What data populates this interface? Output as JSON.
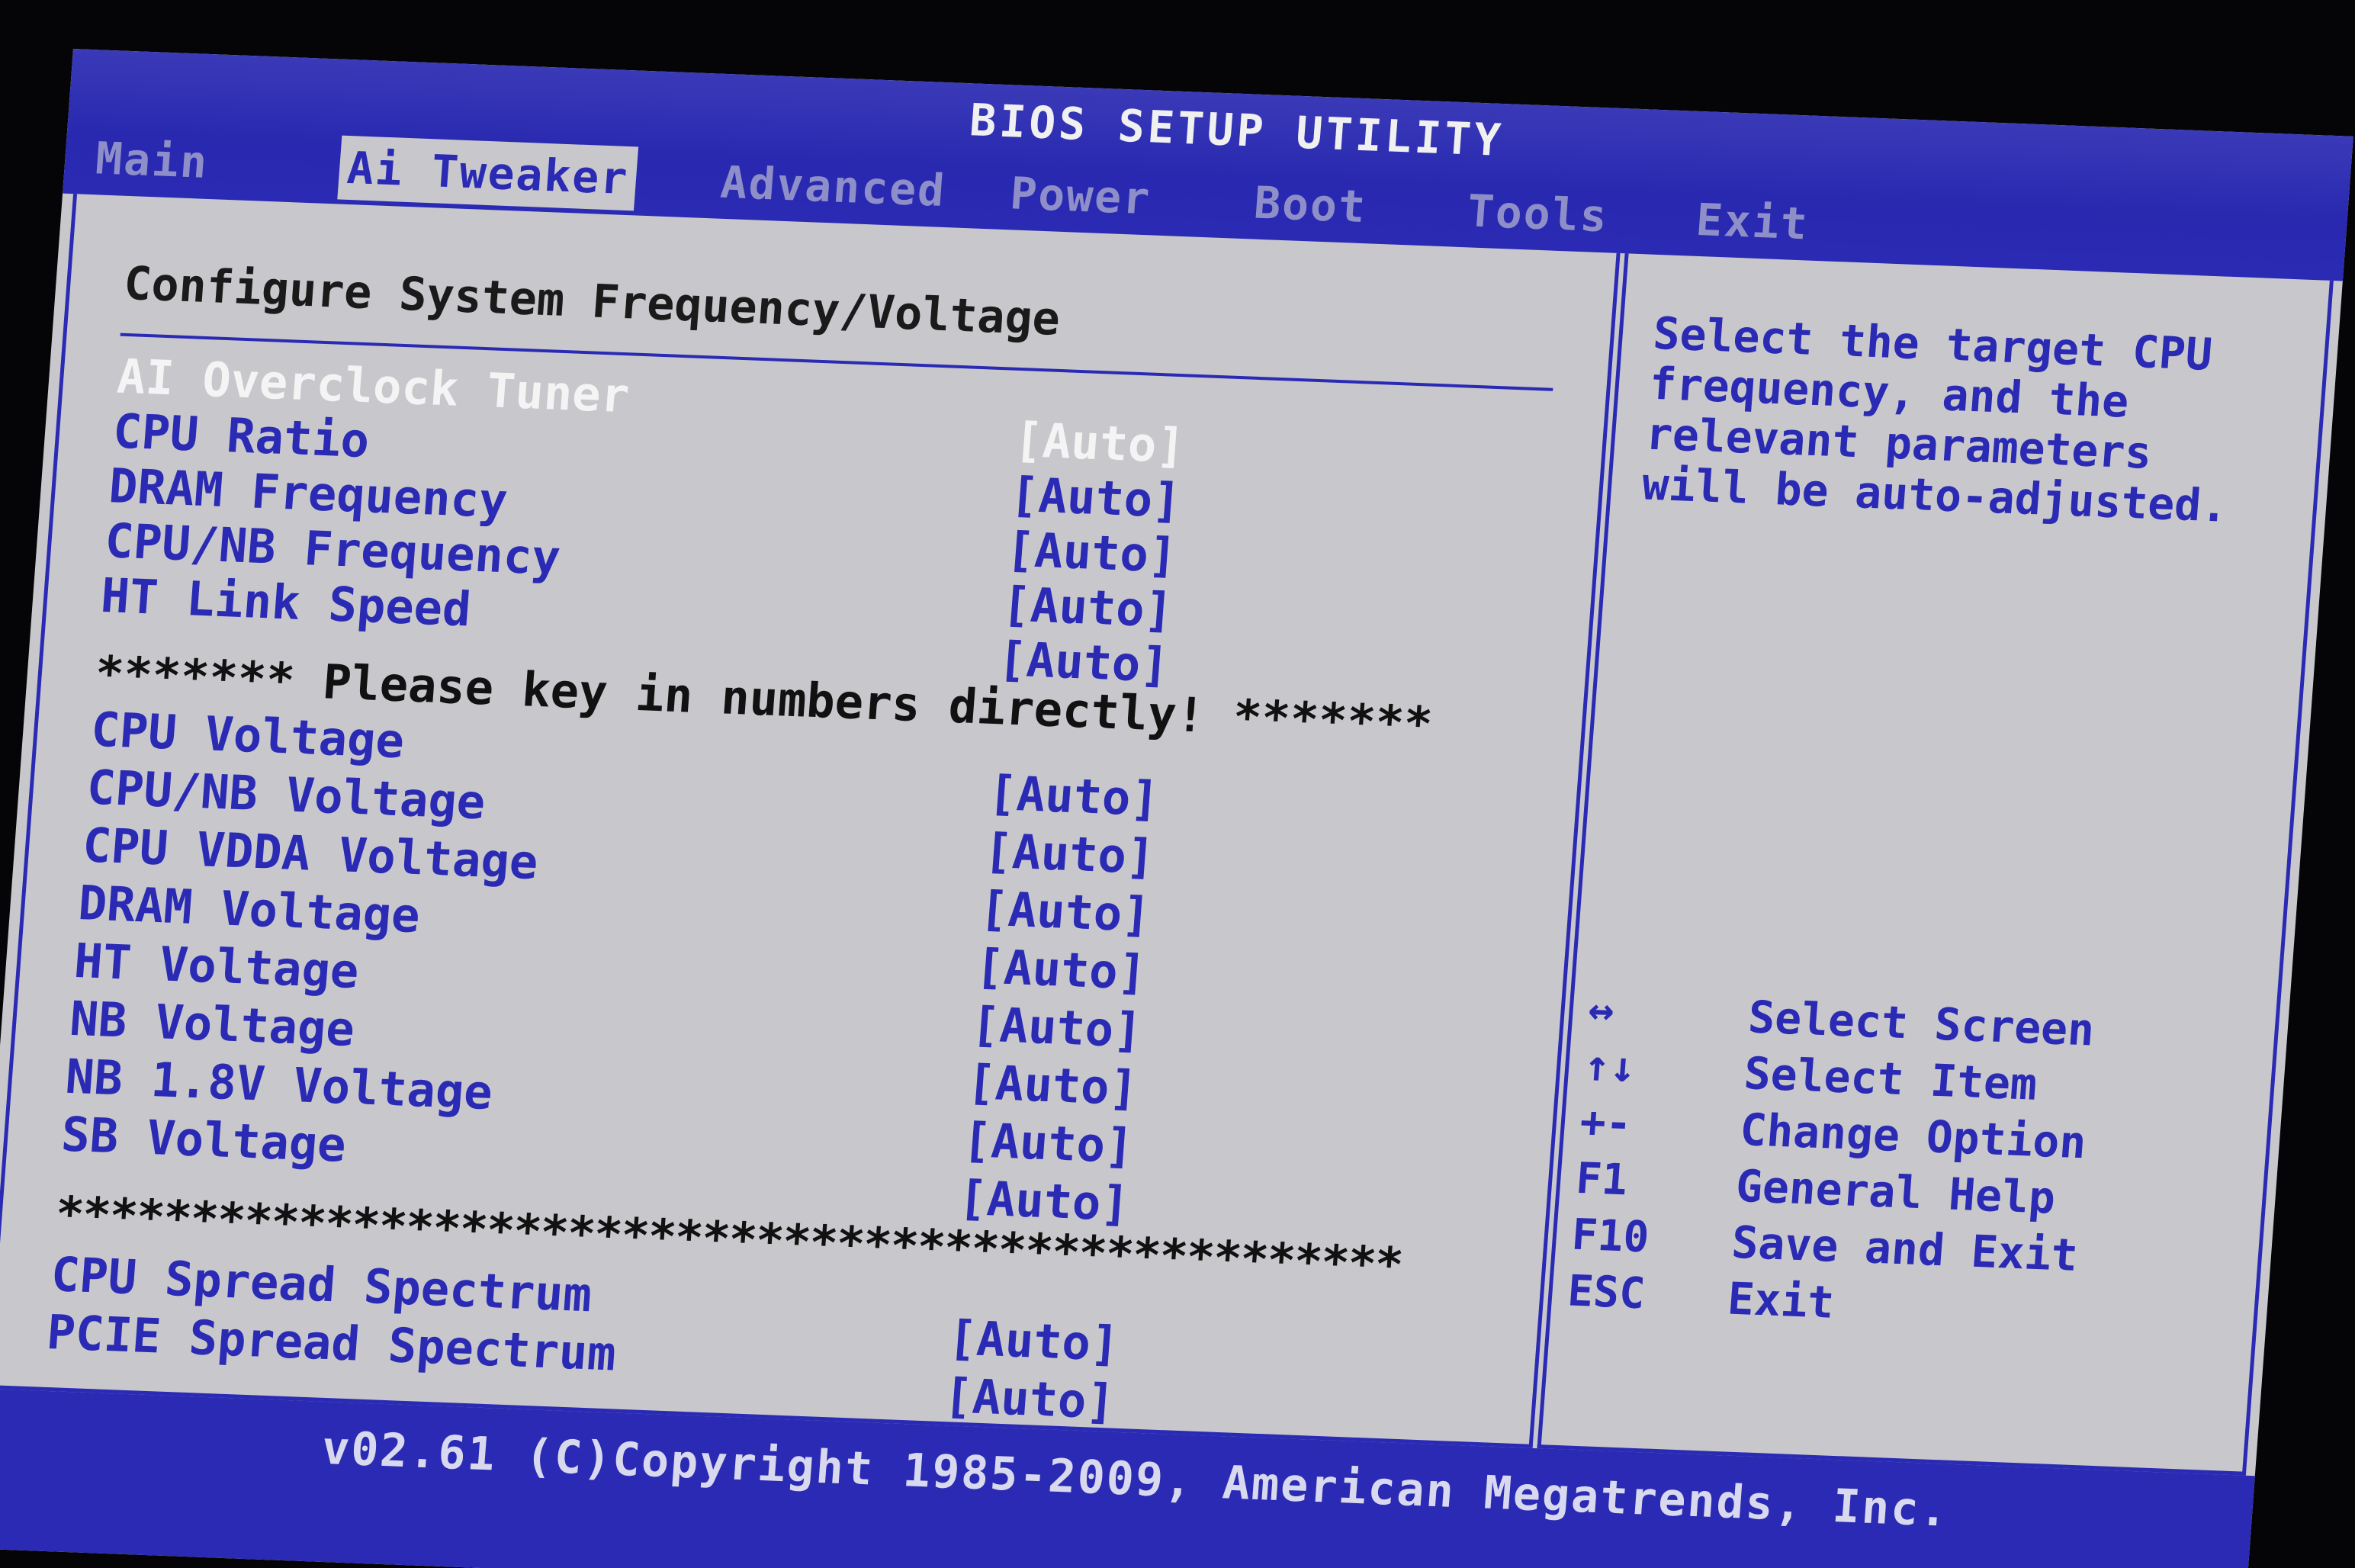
{
  "header": {
    "title": "BIOS SETUP UTILITY"
  },
  "tabs": [
    {
      "label": "Main",
      "active": false
    },
    {
      "label": "Ai Tweaker",
      "active": true
    },
    {
      "label": "Advanced",
      "active": false
    },
    {
      "label": "Power",
      "active": false
    },
    {
      "label": "Boot",
      "active": false
    },
    {
      "label": "Tools",
      "active": false
    },
    {
      "label": "Exit",
      "active": false
    }
  ],
  "main": {
    "section_title": "Configure System Frequency/Voltage",
    "group1": [
      {
        "label": "AI Overclock Tuner",
        "value": "[Auto]",
        "selected": true
      },
      {
        "label": "CPU Ratio",
        "value": "[Auto]"
      },
      {
        "label": "DRAM Frequency",
        "value": "[Auto]"
      },
      {
        "label": "CPU/NB Frequency",
        "value": "[Auto]"
      },
      {
        "label": "HT Link Speed",
        "value": "[Auto]"
      }
    ],
    "notice": "******* Please key in numbers directly! *******",
    "group2": [
      {
        "label": "CPU Voltage",
        "value": "[Auto]"
      },
      {
        "label": "CPU/NB Voltage",
        "value": "[Auto]"
      },
      {
        "label": "CPU VDDA Voltage",
        "value": "[Auto]"
      },
      {
        "label": "DRAM Voltage",
        "value": "[Auto]"
      },
      {
        "label": "HT Voltage",
        "value": "[Auto]"
      },
      {
        "label": "NB Voltage",
        "value": "[Auto]"
      },
      {
        "label": "NB 1.8V Voltage",
        "value": "[Auto]"
      },
      {
        "label": "SB Voltage",
        "value": "[Auto]"
      }
    ],
    "separator": "**************************************************",
    "group3": [
      {
        "label": "CPU Spread Spectrum",
        "value": "[Auto]"
      },
      {
        "label": "PCIE Spread Spectrum",
        "value": "[Auto]"
      }
    ]
  },
  "help": {
    "text": "Select the target CPU\nfrequency, and the\nrelevant parameters\nwill be auto-adjusted.",
    "keys": [
      {
        "key": "↔",
        "desc": "Select Screen"
      },
      {
        "key": "↑↓",
        "desc": "Select Item"
      },
      {
        "key": "+-",
        "desc": "Change Option"
      },
      {
        "key": "F1",
        "desc": "General Help"
      },
      {
        "key": "F10",
        "desc": "Save and Exit"
      },
      {
        "key": "ESC",
        "desc": "Exit"
      }
    ]
  },
  "footer": {
    "text": "v02.61 (C)Copyright 1985-2009, American Megatrends, Inc."
  },
  "colors": {
    "bios_blue": "#2a2ab4",
    "panel_gray": "#c8c8cc",
    "highlight_white": "#f4f4f4"
  }
}
